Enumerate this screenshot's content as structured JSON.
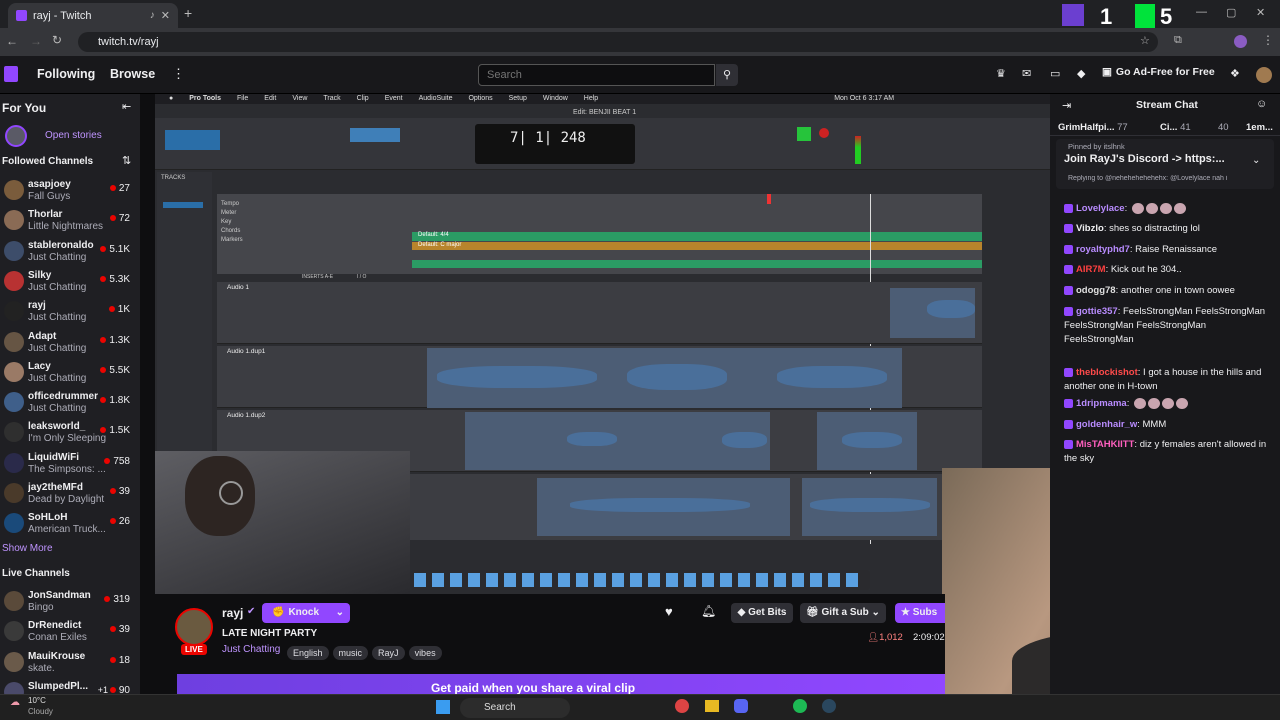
{
  "browser": {
    "tab_title": "rayj - Twitch",
    "url": "twitch.tv/rayj"
  },
  "topnav": {
    "following": "Following",
    "browse": "Browse",
    "search_placeholder": "Search",
    "go_ad_free": "Go Ad-Free for Free"
  },
  "sidebar": {
    "for_you": "For You",
    "open_stories": "Open stories",
    "followed_channels": "Followed Channels",
    "show_more": "Show More",
    "live_channels": "Live Channels",
    "channels": [
      {
        "name": "asapjoey",
        "game": "Fall Guys",
        "viewers": "27",
        "color": "#7a5c3c"
      },
      {
        "name": "Thorlar",
        "game": "Little Nightmares",
        "viewers": "72",
        "color": "#8a6b55"
      },
      {
        "name": "stableronaldo",
        "game": "Just Chatting",
        "viewers": "5.1K",
        "color": "#3d4d6a"
      },
      {
        "name": "Silky",
        "game": "Just Chatting",
        "viewers": "5.3K",
        "color": "#b83232"
      },
      {
        "name": "rayj",
        "game": "Just Chatting",
        "viewers": "1K",
        "color": "#222"
      },
      {
        "name": "Adapt",
        "game": "Just Chatting",
        "viewers": "1.3K",
        "color": "#665544"
      },
      {
        "name": "Lacy",
        "game": "Just Chatting",
        "viewers": "5.5K",
        "color": "#9a7a66"
      },
      {
        "name": "officedrummer",
        "game": "Just Chatting",
        "viewers": "1.8K",
        "color": "#3f5f8a"
      },
      {
        "name": "leaksworld_",
        "game": "I'm Only Sleeping",
        "viewers": "1.5K",
        "color": "#2f2f2f"
      },
      {
        "name": "LiquidWiFi",
        "game": "The Simpsons: ...",
        "viewers": "758",
        "color": "#2a2a4a"
      },
      {
        "name": "jay2theMFd",
        "game": "Dead by Daylight",
        "viewers": "39",
        "color": "#4a3a2a"
      },
      {
        "name": "SoHLoH",
        "game": "American Truck...",
        "viewers": "26",
        "color": "#1a4a7a"
      }
    ],
    "live": [
      {
        "name": "JonSandman",
        "game": "Bingo",
        "viewers": "319",
        "color": "#5a4a3a"
      },
      {
        "name": "DrRenedict",
        "game": "Conan Exiles",
        "viewers": "39",
        "color": "#3a3a3a"
      },
      {
        "name": "MauiKrouse",
        "game": "skate.",
        "viewers": "18",
        "color": "#6a5a4a"
      },
      {
        "name": "SlumpedPl...",
        "game": "",
        "viewers": "90",
        "color": "#4a4a6a",
        "extra": "+1"
      }
    ]
  },
  "daw": {
    "title": "Edit: BENJII BEAT 1",
    "menu": [
      "Pro Tools",
      "File",
      "Edit",
      "View",
      "Track",
      "Clip",
      "Event",
      "AudioSuite",
      "Options",
      "Setup",
      "Window",
      "Help"
    ],
    "clock": "Mon Oct 6  3:17 AM",
    "counter": "7| 1| 248",
    "tracks_label": "TRACKS",
    "tracks": [
      "Audio 1",
      "Audio 1.dup1",
      "Audio 1.dup2"
    ],
    "io_labels": [
      "INSERTS A-E",
      "I / O"
    ],
    "rulers": [
      "Tempo",
      "Meter",
      "Key",
      "Chords",
      "Markers"
    ],
    "meter_default": "Default: 4/4",
    "key_default": "Default: C major"
  },
  "stream_info": {
    "streamer": "rayj",
    "knock": "Knock",
    "title": "LATE NIGHT PARTY",
    "live_badge": "LIVE",
    "category": "Just Chatting",
    "tags": [
      "English",
      "music",
      "RayJ",
      "vibes"
    ],
    "get_bits": "Get Bits",
    "gift_sub": "Gift a Sub",
    "subscribe": "Subs",
    "viewers": "1,012",
    "uptime": "2:09:02",
    "banner": "Get paid when you share a viral clip"
  },
  "chat": {
    "header": "Stream Chat",
    "top_gifters": [
      {
        "name": "GrimHalfpi...",
        "count": "77"
      },
      {
        "name": "Ci...",
        "count": "41"
      },
      {
        "name": "",
        "count": "40"
      },
      {
        "name": "1em...",
        "count": ""
      }
    ],
    "pinned_by": "Pinned by",
    "pinned_user": "itslhnk",
    "pinned_message": "Join RayJ's Discord -> https:...",
    "replying": "Replying to @nehehehehehehx: @Lovelylace nah i",
    "messages": [
      {
        "user": "Lovelylace",
        "color": "#b98cff",
        "text": ""
      },
      {
        "user": "Vibzlo",
        "color": "#efeff1",
        "text": "shes so distracting lol"
      },
      {
        "user": "royaltyphd7",
        "color": "#b98cff",
        "text": "Raise Renaissance"
      },
      {
        "user": "AIR7M",
        "color": "#ff4040",
        "text": "Kick out he 304.."
      },
      {
        "user": "odogg78",
        "color": "#e0e0e0",
        "text": "another one in town oowee"
      },
      {
        "user": "gottie357",
        "color": "#b98cff",
        "text": "FeelsStrongMan FeelsStrongMan FeelsStrongMan FeelsStrongMan FeelsStrongMan"
      },
      {
        "user": "theblockishot",
        "color": "#ff4b4b",
        "text": "I got a house in the hills and another one in H-town"
      },
      {
        "user": "1dripmama",
        "color": "#b98cff",
        "text": ""
      },
      {
        "user": "goldenhair_w",
        "color": "#b98cff",
        "text": "MMM"
      },
      {
        "user": "MisTAHKIITT",
        "color": "#ff5fbf",
        "text": "diz y females aren't allowed in the sky"
      }
    ]
  },
  "taskbar": {
    "temp": "10°C",
    "weather": "Cloudy",
    "search": "Search"
  },
  "colors": {
    "twitch_purple": "#9147ff",
    "live_red": "#eb0400",
    "wave_blue": "#4a6f9a"
  }
}
